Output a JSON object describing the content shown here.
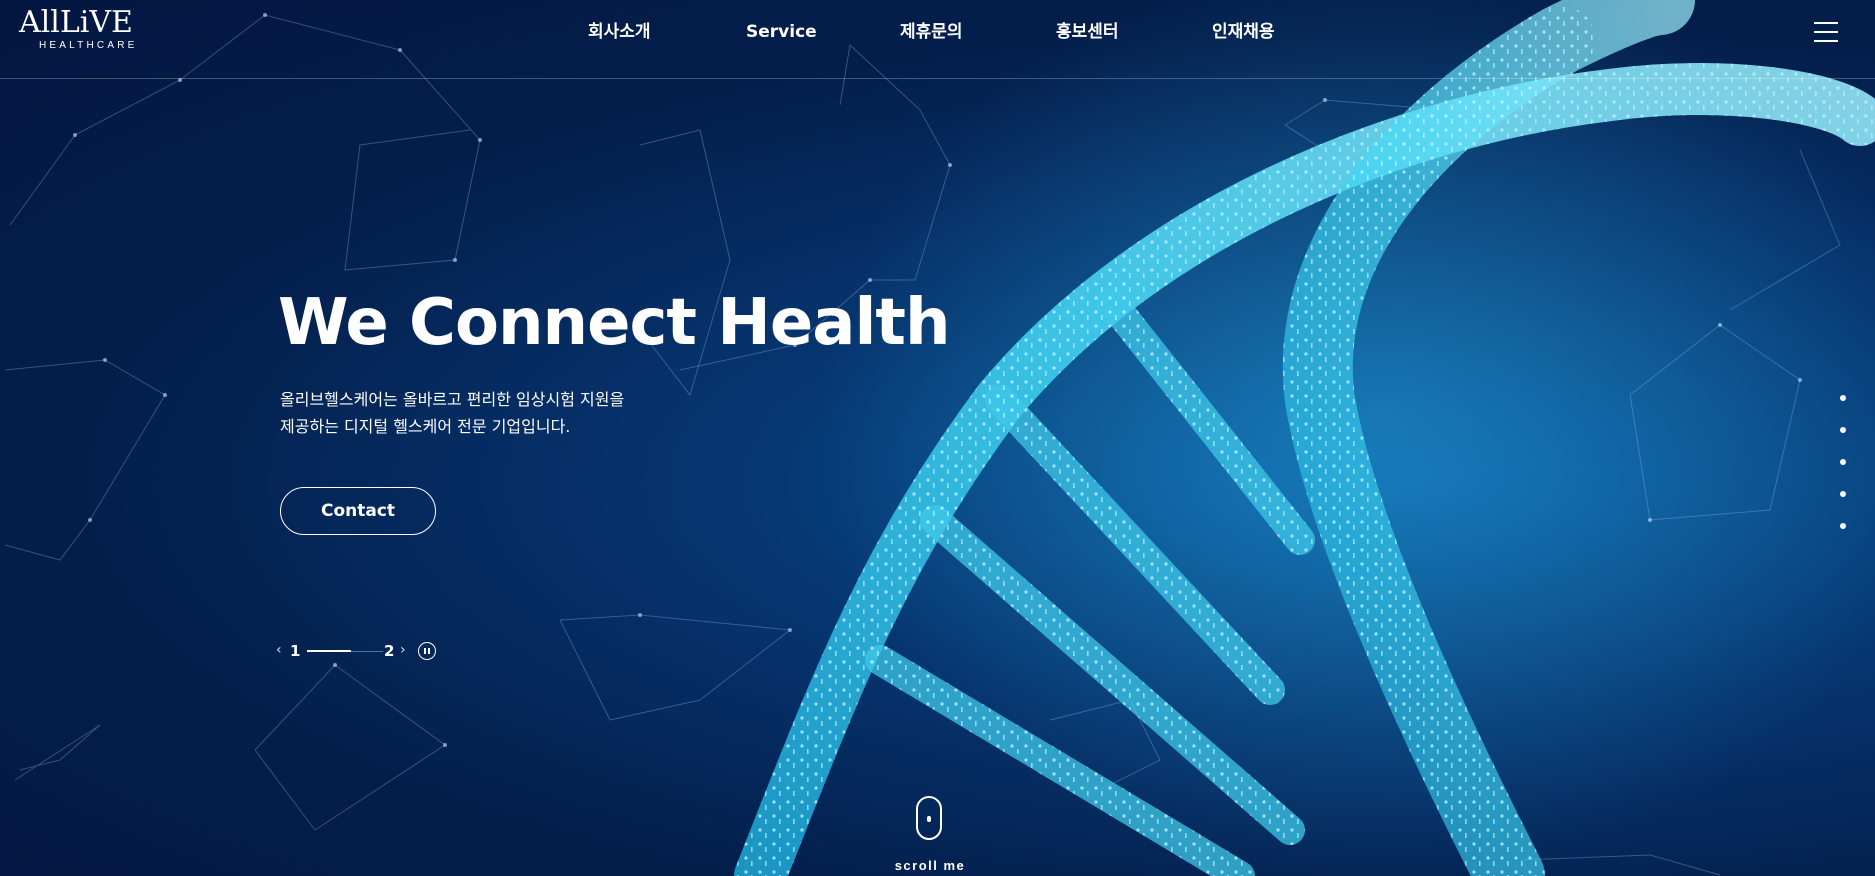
{
  "header": {
    "logo": {
      "main": "AllLiVE",
      "sub": "HEALTHCARE"
    },
    "nav": [
      {
        "label": "회사소개"
      },
      {
        "label": "Service"
      },
      {
        "label": "제휴문의"
      },
      {
        "label": "홍보센터"
      },
      {
        "label": "인재채용"
      }
    ],
    "menu_icon": "hamburger-menu-icon"
  },
  "hero": {
    "title": "We Connect Health",
    "desc_line1": "올리브헬스케어는 올바르고 편리한 임상시험 지원을",
    "desc_line2": "제공하는 디지털 헬스케어 전문 기업입니다.",
    "contact_label": "Contact"
  },
  "pager": {
    "prev_icon": "chevron-left-icon",
    "next_icon": "chevron-right-icon",
    "prev_glyph": "‹",
    "next_glyph": "›",
    "current": "1",
    "total": "2",
    "progress": 0.58,
    "pause_icon": "pause-icon"
  },
  "side_nav": {
    "count": 5,
    "icon": "dot-icon"
  },
  "scroll": {
    "label": "scroll me",
    "icon": "mouse-icon"
  },
  "colors": {
    "bg_dark": "#031640",
    "bg_mid": "#06356f",
    "dna": "#3fd3f0",
    "text": "#ffffff"
  }
}
